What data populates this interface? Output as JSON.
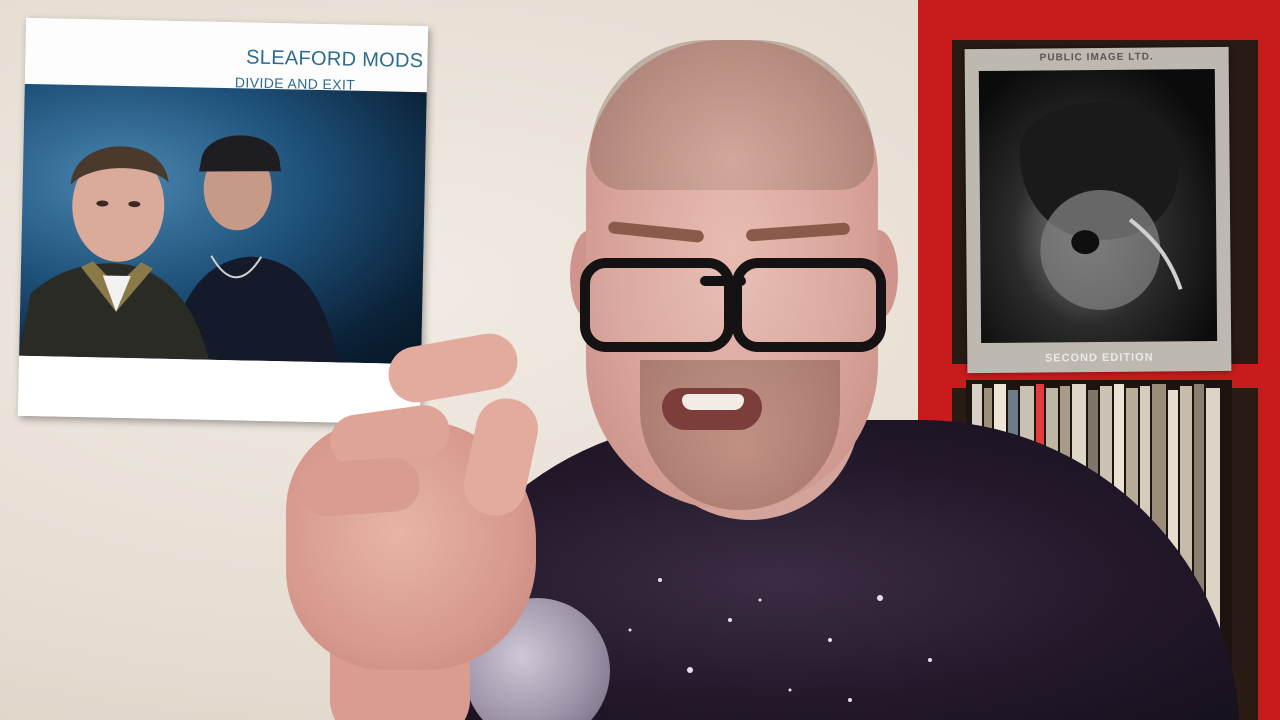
{
  "poster": {
    "artist": "SLEAFORD MODS",
    "album": "DIVIDE AND EXIT"
  },
  "record": {
    "title": "PUBLIC IMAGE LTD.",
    "subtitle": "SECOND EDITION"
  },
  "colors": {
    "wall": "#e9e2d8",
    "shelf": "#c81b1b",
    "poster_text": "#2c6d8f",
    "shirt": "#2a1f33"
  }
}
